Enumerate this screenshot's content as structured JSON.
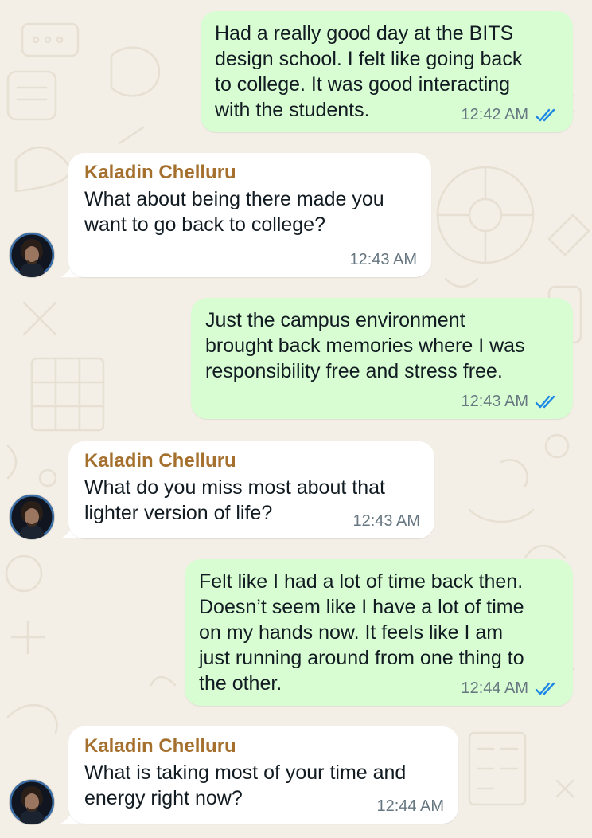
{
  "chat": {
    "contact_name": "Kaladin Chelluru",
    "messages": [
      {
        "direction": "outgoing",
        "text": "Had a really good day at the BITS\ndesign school. I felt like going back\nto college. It was good interacting\nwith the students.",
        "time": "12:42 AM",
        "status": "read"
      },
      {
        "direction": "incoming",
        "sender": "Kaladin Chelluru",
        "text": "What about being there made you\nwant to go back to college?",
        "time": "12:43 AM"
      },
      {
        "direction": "outgoing",
        "text": "Just the campus environment\nbrought back memories where I was\nresponsibility free and stress free.",
        "time": "12:43 AM",
        "status": "read"
      },
      {
        "direction": "incoming",
        "sender": "Kaladin Chelluru",
        "text": "What do you miss most about that\nlighter version of life?",
        "time": "12:43 AM"
      },
      {
        "direction": "outgoing",
        "text": "Felt like I had a lot of time back then.\nDoesn’t seem like I have a lot of time\non my hands now. It feels like I am\njust running around from one thing to\nthe other.",
        "time": "12:44 AM",
        "status": "read"
      },
      {
        "direction": "incoming",
        "sender": "Kaladin Chelluru",
        "text": "What is taking most of your time and\nenergy right now?",
        "time": "12:44 AM"
      }
    ]
  },
  "colors": {
    "outgoing_bubble": "#d9fdd3",
    "incoming_bubble": "#ffffff",
    "sender_name": "#a5702d",
    "read_ticks": "#1e88e5",
    "timestamp": "#667781",
    "wallpaper": "#f3efe7"
  },
  "icons": {
    "read_receipt": "double-check-icon",
    "avatar": "contact-avatar"
  }
}
